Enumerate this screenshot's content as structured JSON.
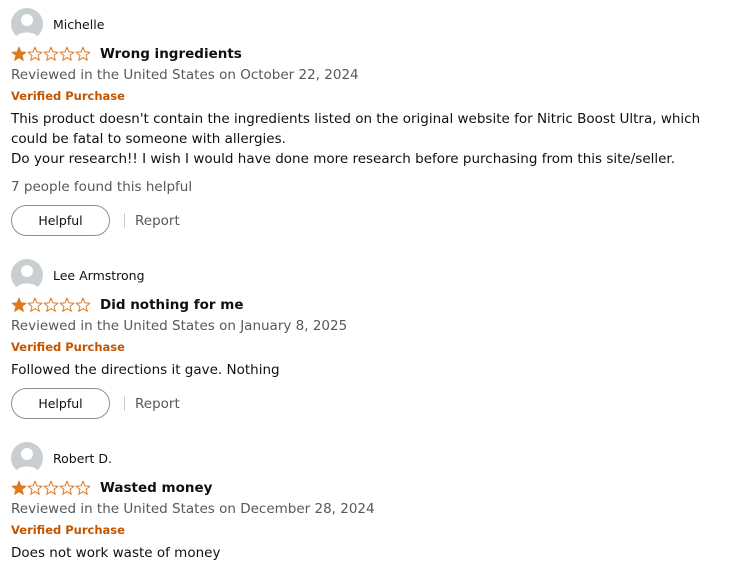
{
  "reviews": [
    {
      "author": "Michelle",
      "rating": 1,
      "rating_max": 5,
      "title": "Wrong ingredients",
      "date_line": "Reviewed in the United States on October 22, 2024",
      "verified": "Verified Purchase",
      "body_lines": [
        "This product doesn't contain the ingredients listed on the original website for Nitric Boost Ultra, which",
        "could be fatal to someone with allergies.",
        "Do your research!! I wish I would have done more research before purchasing from this site/seller."
      ],
      "helpful_count": "7 people found this helpful",
      "helpful_label": "Helpful",
      "report_label": "Report"
    },
    {
      "author": "Lee Armstrong",
      "rating": 1,
      "rating_max": 5,
      "title": "Did nothing for me",
      "date_line": "Reviewed in the United States on January 8, 2025",
      "verified": "Verified Purchase",
      "body_lines": [
        "Followed the directions it gave. Nothing"
      ],
      "helpful_label": "Helpful",
      "report_label": "Report"
    },
    {
      "author": "Robert D.",
      "rating": 1,
      "rating_max": 5,
      "title": "Wasted money",
      "date_line": "Reviewed in the United States on December 28, 2024",
      "verified": "Verified Purchase",
      "body_lines": [
        "Does not work waste of money"
      ]
    }
  ],
  "icons": {
    "avatar": "avatar-placeholder-icon",
    "star_filled": "star-filled-icon",
    "star_empty": "star-empty-icon"
  },
  "colors": {
    "star": "#de7921",
    "verified": "#c45500",
    "secondary_text": "#565959",
    "avatar_bg": "#c9ced1"
  }
}
